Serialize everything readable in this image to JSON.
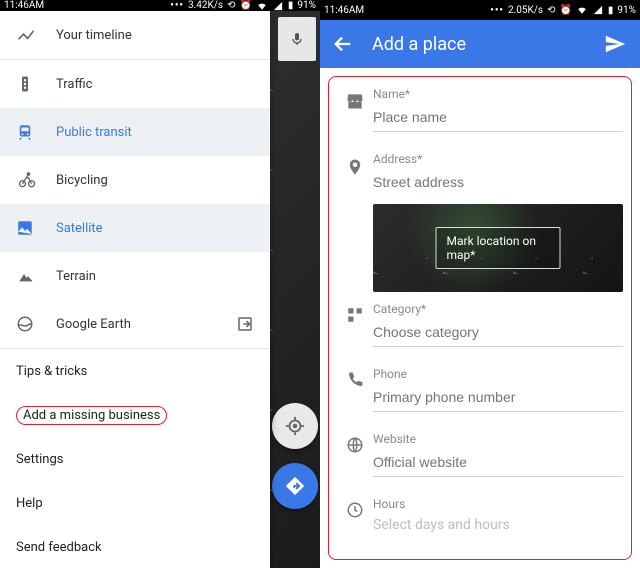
{
  "status": {
    "time": "11:46AM",
    "left_net": "3.42K/s",
    "right_net": "2.05K/s",
    "battery": "91%"
  },
  "left": {
    "menu": {
      "timeline": "Your timeline",
      "traffic": "Traffic",
      "transit": "Public transit",
      "bicycling": "Bicycling",
      "satellite": "Satellite",
      "terrain": "Terrain",
      "earth": "Google Earth",
      "tips": "Tips & tricks",
      "add_business": "Add a missing business",
      "settings": "Settings",
      "help": "Help",
      "feedback": "Send feedback"
    }
  },
  "right": {
    "title": "Add a place",
    "name_label": "Name*",
    "name_placeholder": "Place name",
    "address_label": "Address*",
    "address_placeholder": "Street address",
    "mark_location": "Mark location on map*",
    "category_label": "Category*",
    "category_placeholder": "Choose category",
    "phone_label": "Phone",
    "phone_placeholder": "Primary phone number",
    "website_label": "Website",
    "website_placeholder": "Official website",
    "hours_label": "Hours",
    "hours_placeholder": "Select days and hours"
  }
}
